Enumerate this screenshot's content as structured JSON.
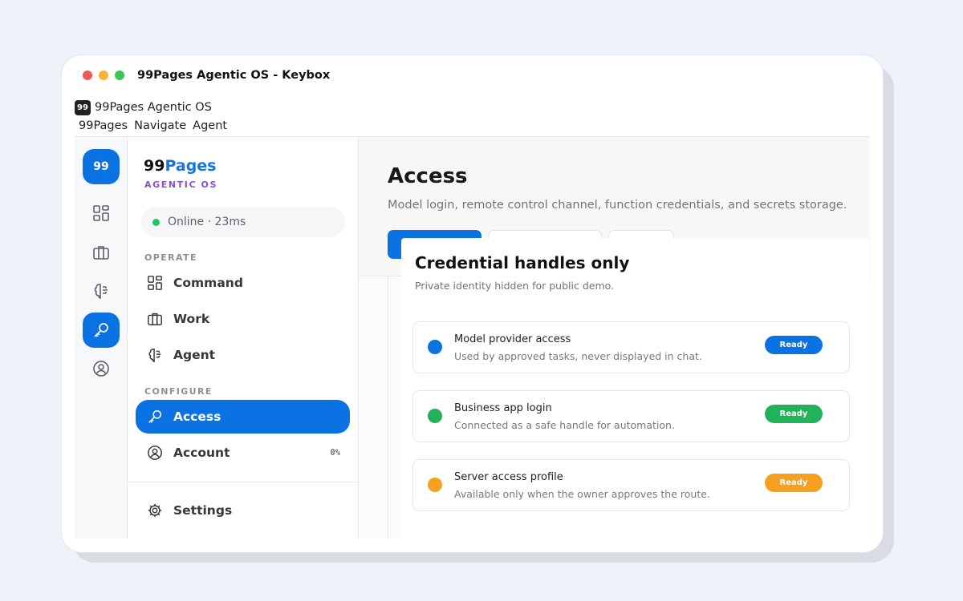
{
  "window": {
    "title": "99Pages Agentic OS - Keybox"
  },
  "app": {
    "logo": "99",
    "name": "99Pages Agentic OS"
  },
  "menubar": [
    "99Pages",
    "Navigate",
    "Agent"
  ],
  "rail": {
    "brand": "99",
    "icons": [
      "grid-icon",
      "briefcase-icon",
      "brain-icon",
      "key-icon",
      "user-circle-icon"
    ]
  },
  "sidebar": {
    "brand_main": "99",
    "brand_accent": "Pages",
    "brand_sub": "AGENTIC OS",
    "status": "Online · 23ms",
    "sections": {
      "operate": "OPERATE",
      "configure": "CONFIGURE"
    },
    "items": [
      {
        "label": "Command",
        "icon": "grid-icon"
      },
      {
        "label": "Work",
        "icon": "briefcase-icon"
      },
      {
        "label": "Agent",
        "icon": "brain-icon"
      },
      {
        "label": "Access",
        "icon": "key-icon",
        "active": true
      },
      {
        "label": "Account",
        "icon": "user-circle-icon",
        "badge": "0%"
      },
      {
        "label": "Settings",
        "icon": "gear-icon"
      }
    ]
  },
  "main": {
    "title": "Access",
    "description": "Model login, remote control channel, function credentials, and secrets storage."
  },
  "card": {
    "title": "Credential handles only",
    "subtitle": "Private identity hidden for public demo.",
    "rows": [
      {
        "name": "Model provider access",
        "desc": "Used by approved tasks, never displayed in chat.",
        "badge": "Ready",
        "color": "#0b72e3"
      },
      {
        "name": "Business app login",
        "desc": "Connected as a safe handle for automation.",
        "badge": "Ready",
        "color": "#22b35a"
      },
      {
        "name": "Server access profile",
        "desc": "Available only when the owner approves the route.",
        "badge": "Ready",
        "color": "#f6a021"
      }
    ]
  },
  "colors": {
    "accent": "#0b72e3",
    "success": "#22b35a",
    "warning": "#f6a021",
    "brand_purple": "#8a4fd6"
  }
}
